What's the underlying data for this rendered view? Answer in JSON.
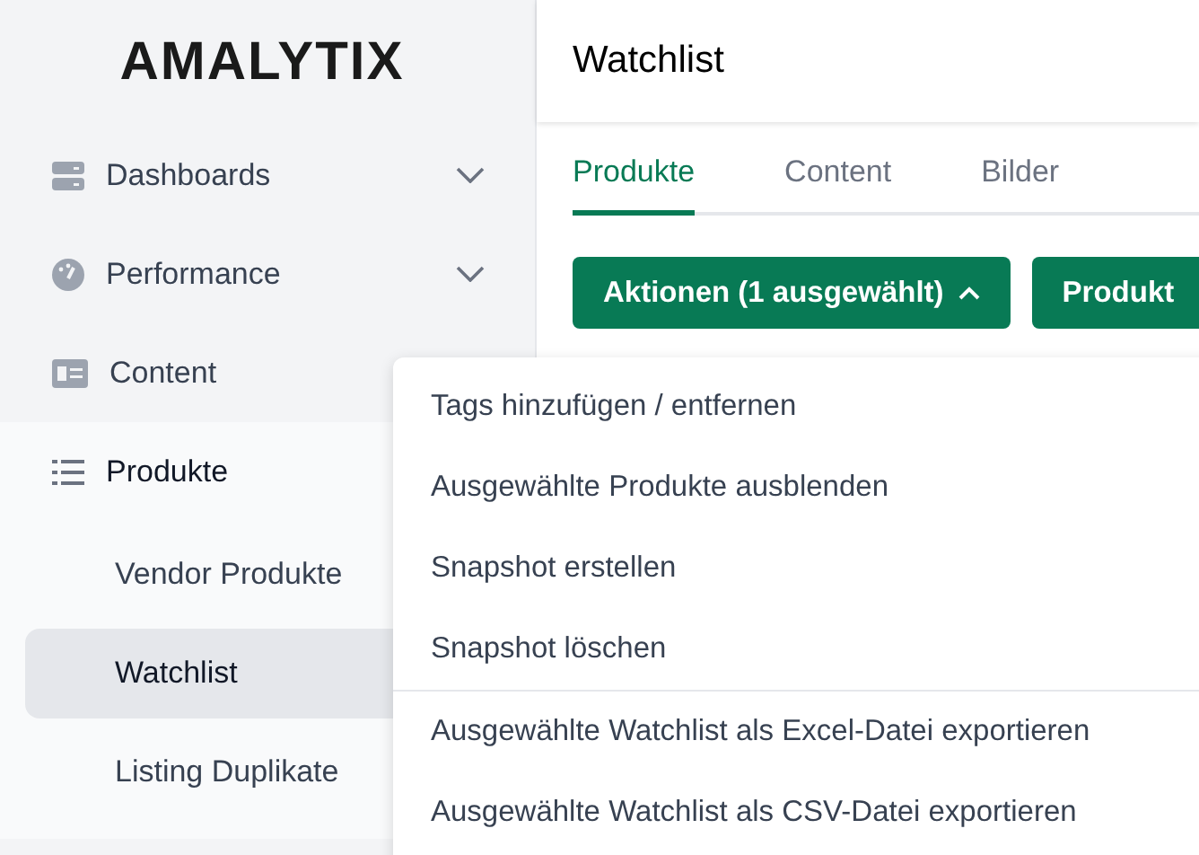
{
  "logo": "AMALYTIX",
  "sidebar": {
    "items": [
      {
        "label": "Dashboards",
        "expanded": false
      },
      {
        "label": "Performance",
        "expanded": false
      },
      {
        "label": "Content"
      },
      {
        "label": "Produkte",
        "expanded": true,
        "children": [
          {
            "label": "Vendor Produkte",
            "selected": false
          },
          {
            "label": "Watchlist",
            "selected": true
          },
          {
            "label": "Listing Duplikate",
            "selected": false
          }
        ]
      }
    ]
  },
  "page_title": "Watchlist",
  "tabs": [
    {
      "label": "Produkte",
      "selected": true
    },
    {
      "label": "Content",
      "selected": false
    },
    {
      "label": "Bilder",
      "selected": false
    }
  ],
  "buttons": [
    {
      "label": "Aktionen (1 ausgewählt)",
      "open": true
    },
    {
      "label": "Produkt",
      "open": false
    }
  ],
  "menu": {
    "items": [
      {
        "label": "Tags hinzufügen / entfernen",
        "separator_before": false
      },
      {
        "label": "Ausgewählte Produkte ausblenden",
        "separator_before": false
      },
      {
        "label": "Snapshot erstellen",
        "separator_before": false
      },
      {
        "label": "Snapshot löschen",
        "separator_before": false
      },
      {
        "label": "Ausgewählte Watchlist als Excel-Datei exportieren",
        "separator_before": true
      },
      {
        "label": "Ausgewählte Watchlist als CSV-Datei exportieren",
        "separator_before": false
      }
    ]
  }
}
